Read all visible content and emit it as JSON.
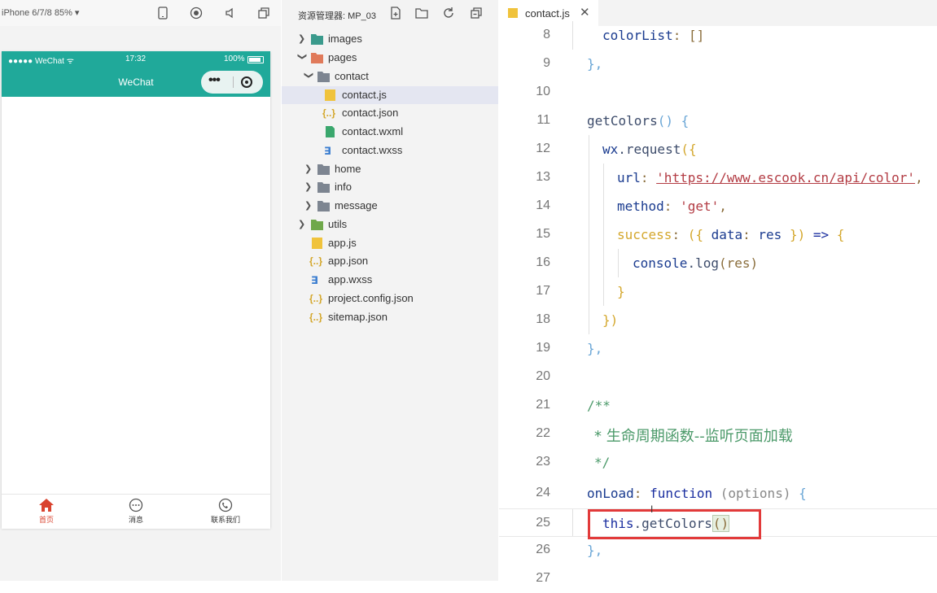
{
  "simulator": {
    "device_label": "iPhone 6/7/8 85% ▾",
    "tools": [
      "phone-icon",
      "record-icon",
      "volume-icon",
      "window-icon"
    ],
    "status": {
      "carrier": "●●●●● WeChat ᯤ",
      "time": "17:32",
      "battery": "100%"
    },
    "nav_title": "WeChat",
    "capsule_more": "•••",
    "tabs": [
      {
        "label": "首页",
        "icon": "home-icon",
        "active": true
      },
      {
        "label": "消息",
        "icon": "message-icon",
        "active": false
      },
      {
        "label": "联系我们",
        "icon": "phone-call-icon",
        "active": false
      }
    ],
    "accent_color": "#20a99a"
  },
  "explorer": {
    "title": "资源管理器: MP_03",
    "tree": {
      "images": "images",
      "pages": "pages",
      "contact": "contact",
      "contact_js": "contact.js",
      "contact_json": "contact.json",
      "contact_wxml": "contact.wxml",
      "contact_wxss": "contact.wxss",
      "home": "home",
      "info": "info",
      "message": "message",
      "utils": "utils",
      "app_js": "app.js",
      "app_json": "app.json",
      "app_wxss": "app.wxss",
      "project_config": "project.config.json",
      "sitemap": "sitemap.json"
    }
  },
  "editor": {
    "tab_name": "contact.js",
    "tab_close": "✕",
    "line_numbers": [
      "8",
      "9",
      "10",
      "11",
      "12",
      "13",
      "14",
      "15",
      "16",
      "17",
      "18",
      "19",
      "20",
      "21",
      "22",
      "23",
      "24",
      "25",
      "26",
      "27"
    ],
    "code": {
      "l8_key": "colorList",
      "l8_rest": ": []",
      "l9": "},",
      "l11_fn": "getColors",
      "l11_rest": "() {",
      "l12_obj": "wx",
      "l12_method": ".request",
      "l12_rest": "({",
      "l13_key": "url",
      "l13_colon": ": ",
      "l13_url": "'https://www.escook.cn/api/color'",
      "l13_comma": ",",
      "l14_key": "method",
      "l14_colon": ": ",
      "l14_val": "'get'",
      "l14_comma": ",",
      "l15_key": "success",
      "l15_colon": ": ",
      "l15_open": "({ ",
      "l15_data": "data",
      "l15_colon2": ": ",
      "l15_res": "res",
      "l15_close": " }) ",
      "l15_arrow": "=>",
      "l15_brace": " {",
      "l16_console": "console",
      "l16_log": ".log",
      "l16_args": "(res)",
      "l17": "}",
      "l18": "})",
      "l19": "},",
      "l21": "/**",
      "l22": "* 生命周期函数--监听页面加载",
      "l23": "*/",
      "l24_key": "onLoad",
      "l24_colon": ": ",
      "l24_kw": "function",
      "l24_args": " (options)",
      "l24_brace": " {",
      "l25_this": "this",
      "l25_call": ".getColors",
      "l25_paren": "()",
      "l26": "},"
    },
    "highlight_color": "#e23a3a"
  }
}
